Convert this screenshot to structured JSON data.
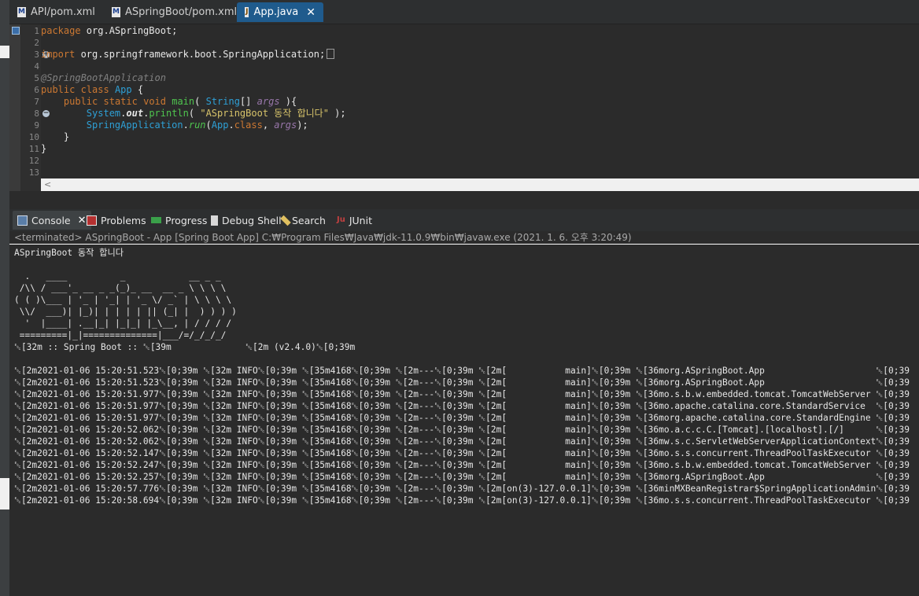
{
  "editor_tabs": [
    {
      "label": "API/pom.xml",
      "icon": "xml-file-icon"
    },
    {
      "label": "ASpringBoot/pom.xml",
      "icon": "xml-file-icon"
    },
    {
      "label": "App.java",
      "icon": "java-file-icon",
      "active": true
    }
  ],
  "editor": {
    "lines": [
      {
        "n": "1"
      },
      {
        "n": "2"
      },
      {
        "n": "3"
      },
      {
        "n": "4"
      },
      {
        "n": "5"
      },
      {
        "n": "6"
      },
      {
        "n": "7"
      },
      {
        "n": "8"
      },
      {
        "n": "9"
      },
      {
        "n": "10"
      },
      {
        "n": "11"
      },
      {
        "n": "12"
      },
      {
        "n": "13"
      }
    ],
    "code": {
      "l1_kw": "package",
      "l1_rest": " org.ASpringBoot;",
      "l3_kw": "import",
      "l3_rest": " org.springframework.boot.SpringApplication;",
      "l6_ann": "@SpringBootApplication",
      "l7_kw1": "public",
      "l7_kw2": "class",
      "l7_cls": "App",
      "l7_brace": " {",
      "l8_indent": "    ",
      "l8_kw1": "public",
      "l8_kw2": "static",
      "l8_kw3": "void",
      "l8_mth": "main",
      "l8_p1": "( ",
      "l8_cls": "String",
      "l8_p2": "[] ",
      "l8_arg": "args",
      "l8_p3": " ){",
      "l9_indent": "        ",
      "l9_cls": "System",
      "l9_dot": ".",
      "l9_out": "out",
      "l9_dot2": ".",
      "l9_mth": "println",
      "l9_p1": "( ",
      "l9_str": "\"ASpringBoot 동작 합니다\"",
      "l9_p2": " );",
      "l10_indent": "        ",
      "l10_cls": "SpringApplication",
      "l10_dot": ".",
      "l10_mth": "run",
      "l10_p1": "(",
      "l10_cls2": "App",
      "l10_dot2": ".",
      "l10_kw": "class",
      "l10_p2": ", ",
      "l10_arg": "args",
      "l10_p3": ");",
      "l11": "    }",
      "l12": "}"
    },
    "scroll_left_glyph": "<"
  },
  "views": [
    {
      "label": "Console",
      "icon": "console-icon",
      "active": true
    },
    {
      "label": "Problems",
      "icon": "problems-icon"
    },
    {
      "label": "Progress",
      "icon": "progress-icon"
    },
    {
      "label": "Debug Shell",
      "icon": "debug-shell-icon"
    },
    {
      "label": "Search",
      "icon": "search-icon"
    },
    {
      "label": "JUnit",
      "icon": "junit-icon"
    }
  ],
  "console": {
    "header": "<terminated> ASpringBoot - App [Spring Boot App] C:₩Program Files₩Java₩jdk-11.0.9₩bin₩javaw.exe (2021. 1. 6. 오후 3:20:49)",
    "lines": [
      "ASpringBoot 동작 합니다",
      "",
      "  .   ____          _            __ _ _",
      " /\\\\ / ___'_ __ _ _(_)_ __  __ _ \\ \\ \\ \\",
      "( ( )\\___ | '_ | '_| | '_ \\/ _` | \\ \\ \\ \\",
      " \\\\/  ___)| |_)| | | | | || (_| |  ) ) ) )",
      "  '  |____| .__|_| |_|_| |_\\__, | / / / /",
      " =========|_|==============|___/=/_/_/_/",
      "\u001b[32m :: Spring Boot :: \u001b[39m              \u001b[2m (v2.4.0)\u001b[0;39m",
      "",
      "\u001b[2m2021-01-06 15:20:51.523\u001b[0;39m \u001b[32m INFO\u001b[0;39m \u001b[35m4168\u001b[0;39m \u001b[2m---\u001b[0;39m \u001b[2m[           main]\u001b[0;39m \u001b[36morg.ASpringBoot.App                     \u001b[0;39",
      "\u001b[2m2021-01-06 15:20:51.523\u001b[0;39m \u001b[32m INFO\u001b[0;39m \u001b[35m4168\u001b[0;39m \u001b[2m---\u001b[0;39m \u001b[2m[           main]\u001b[0;39m \u001b[36morg.ASpringBoot.App                     \u001b[0;39",
      "\u001b[2m2021-01-06 15:20:51.977\u001b[0;39m \u001b[32m INFO\u001b[0;39m \u001b[35m4168\u001b[0;39m \u001b[2m---\u001b[0;39m \u001b[2m[           main]\u001b[0;39m \u001b[36mo.s.b.w.embedded.tomcat.TomcatWebServer \u001b[0;39",
      "\u001b[2m2021-01-06 15:20:51.977\u001b[0;39m \u001b[32m INFO\u001b[0;39m \u001b[35m4168\u001b[0;39m \u001b[2m---\u001b[0;39m \u001b[2m[           main]\u001b[0;39m \u001b[36mo.apache.catalina.core.StandardService  \u001b[0;39",
      "\u001b[2m2021-01-06 15:20:51.977\u001b[0;39m \u001b[32m INFO\u001b[0;39m \u001b[35m4168\u001b[0;39m \u001b[2m---\u001b[0;39m \u001b[2m[           main]\u001b[0;39m \u001b[36morg.apache.catalina.core.StandardEngine \u001b[0;39",
      "\u001b[2m2021-01-06 15:20:52.062\u001b[0;39m \u001b[32m INFO\u001b[0;39m \u001b[35m4168\u001b[0;39m \u001b[2m---\u001b[0;39m \u001b[2m[           main]\u001b[0;39m \u001b[36mo.a.c.c.C.[Tomcat].[localhost].[/]      \u001b[0;39",
      "\u001b[2m2021-01-06 15:20:52.062\u001b[0;39m \u001b[32m INFO\u001b[0;39m \u001b[35m4168\u001b[0;39m \u001b[2m---\u001b[0;39m \u001b[2m[           main]\u001b[0;39m \u001b[36mw.s.c.ServletWebServerApplicationContext\u001b[0;39",
      "\u001b[2m2021-01-06 15:20:52.147\u001b[0;39m \u001b[32m INFO\u001b[0;39m \u001b[35m4168\u001b[0;39m \u001b[2m---\u001b[0;39m \u001b[2m[           main]\u001b[0;39m \u001b[36mo.s.s.concurrent.ThreadPoolTaskExecutor \u001b[0;39",
      "\u001b[2m2021-01-06 15:20:52.247\u001b[0;39m \u001b[32m INFO\u001b[0;39m \u001b[35m4168\u001b[0;39m \u001b[2m---\u001b[0;39m \u001b[2m[           main]\u001b[0;39m \u001b[36mo.s.b.w.embedded.tomcat.TomcatWebServer \u001b[0;39",
      "\u001b[2m2021-01-06 15:20:52.257\u001b[0;39m \u001b[32m INFO\u001b[0;39m \u001b[35m4168\u001b[0;39m \u001b[2m---\u001b[0;39m \u001b[2m[           main]\u001b[0;39m \u001b[36morg.ASpringBoot.App                     \u001b[0;39",
      "\u001b[2m2021-01-06 15:20:57.776\u001b[0;39m \u001b[32m INFO\u001b[0;39m \u001b[35m4168\u001b[0;39m \u001b[2m---\u001b[0;39m \u001b[2m[on(3)-127.0.0.1]\u001b[0;39m \u001b[36minMXBeanRegistrar$SpringApplicationAdmin\u001b[0;39",
      "\u001b[2m2021-01-06 15:20:58.694\u001b[0;39m \u001b[32m INFO\u001b[0;39m \u001b[35m4168\u001b[0;39m \u001b[2m---\u001b[0;39m \u001b[2m[on(3)-127.0.0.1]\u001b[0;39m \u001b[36mo.s.s.concurrent.ThreadPoolTaskExecutor \u001b[0;39"
    ]
  },
  "colors": {
    "active_tab": "#1f5b8d",
    "keyword": "#cc7832",
    "class": "#2ea0d6",
    "method": "#4fc54f",
    "string": "#d7c36a"
  }
}
